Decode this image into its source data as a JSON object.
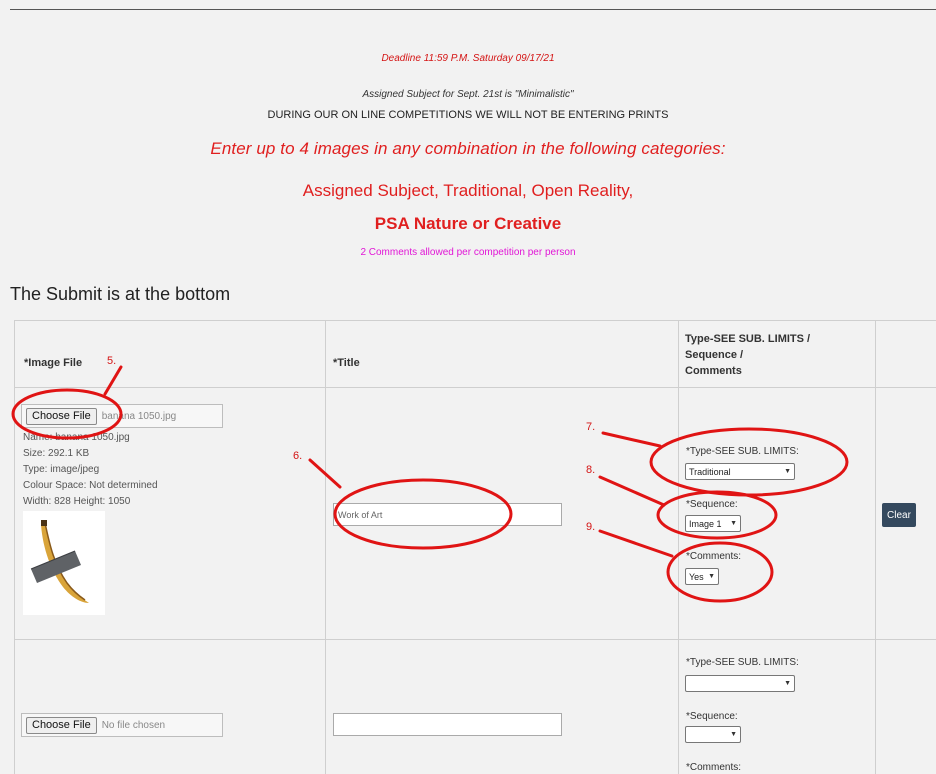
{
  "header": {
    "deadline": "Deadline  11:59 P.M. Saturday 09/17/21",
    "assigned_subject": "Assigned Subject for Sept. 21st is \"Minimalistic\"",
    "no_prints": "DURING OUR ON LINE COMPETITIONS WE WILL NOT BE ENTERING PRINTS",
    "enter_up_to": "Enter up to 4 images in any combination in the following categories:",
    "categories_line1": "Assigned Subject, Traditional, Open Reality,",
    "categories_line2": "PSA Nature or Creative",
    "comments_allowed": "2 Comments allowed per competition per person"
  },
  "submit_note": "The Submit is at the bottom",
  "table": {
    "col_image": "*Image File",
    "col_title": "*Title",
    "col_type_line1": "Type-SEE SUB. LIMITS /",
    "col_type_line2": "Sequence /",
    "col_type_line3": "Comments"
  },
  "row1": {
    "choose_file": "Choose File",
    "file_name_field": "banana 1050.jpg",
    "info_name": "Name: banana 1050.jpg",
    "info_size": "Size: 292.1 KB",
    "info_type": "Type: image/jpeg",
    "info_colour": "Colour Space: Not determined",
    "info_dims": "Width: 828 Height: 1050",
    "title_value": "Work of Art",
    "type_label": "*Type-SEE SUB. LIMITS:",
    "type_value": "Traditional",
    "sequence_label": "*Sequence:",
    "sequence_value": "Image 1",
    "comments_label": "*Comments:",
    "comments_value": "Yes",
    "clear": "Clear"
  },
  "row2": {
    "choose_file": "Choose File",
    "file_name_field": "No file chosen",
    "title_value": "",
    "type_label": "*Type-SEE SUB. LIMITS:",
    "type_value": "",
    "sequence_label": "*Sequence:",
    "sequence_value": "",
    "comments_label": "*Comments:"
  },
  "annotations": [
    "5.",
    "6.",
    "7.",
    "8.",
    "9."
  ],
  "colors": {
    "annotation_red": "#d41414",
    "heading_red": "#e01f1f",
    "magenta": "#e117d6",
    "clear_button": "#34495e"
  }
}
